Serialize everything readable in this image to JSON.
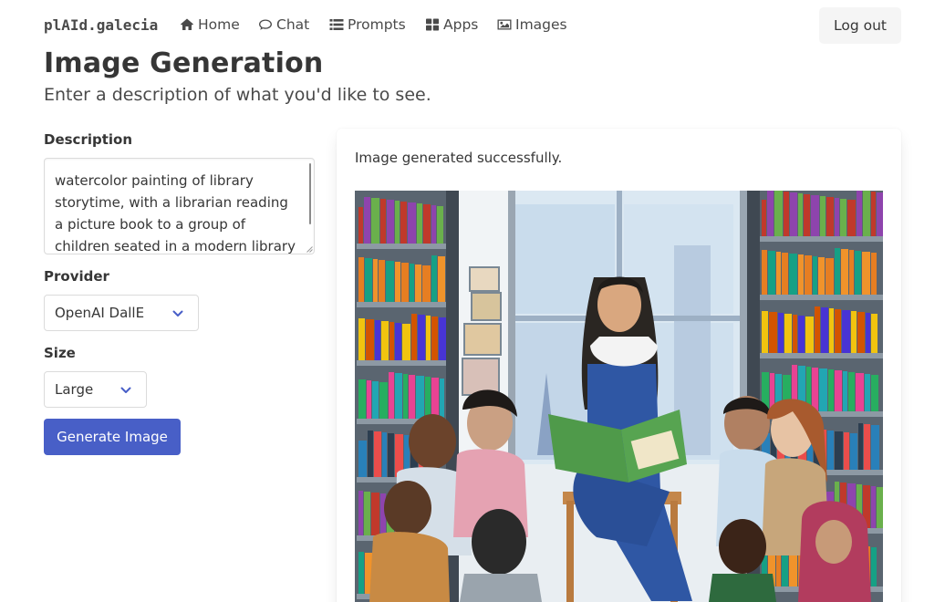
{
  "nav": {
    "brand": "plAId.galecia",
    "items": [
      {
        "label": "Home",
        "icon": "home-icon"
      },
      {
        "label": "Chat",
        "icon": "chat-icon"
      },
      {
        "label": "Prompts",
        "icon": "list-icon"
      },
      {
        "label": "Apps",
        "icon": "apps-icon"
      },
      {
        "label": "Images",
        "icon": "image-icon"
      }
    ],
    "logout_label": "Log out"
  },
  "header": {
    "title": "Image Generation",
    "subtitle": "Enter a description of what you'd like to see."
  },
  "form": {
    "description_label": "Description",
    "description_value": "watercolor painting of library storytime, with a librarian reading a picture book to a group of children seated in a modern library reading",
    "provider_label": "Provider",
    "provider_value": "OpenAI DallE",
    "size_label": "Size",
    "size_value": "Large",
    "generate_label": "Generate Image"
  },
  "result": {
    "status": "Image generated successfully."
  },
  "colors": {
    "primary": "#485fc7",
    "text": "#363636",
    "border": "#dbdbdb"
  }
}
